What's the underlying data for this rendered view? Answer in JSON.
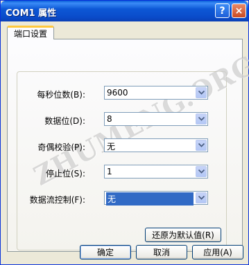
{
  "window": {
    "title": "COM1 属性",
    "help_symbol": "?",
    "close_symbol": "×"
  },
  "tabs": [
    {
      "label": "端口设置"
    }
  ],
  "watermark": "ZHUMENG.ORG",
  "fields": [
    {
      "label": "每秒位数(B):",
      "value": "9600"
    },
    {
      "label": "数据位(D):",
      "value": "8"
    },
    {
      "label": "奇偶校验(P):",
      "value": "无"
    },
    {
      "label": "停止位(S):",
      "value": "1"
    },
    {
      "label": "数据流控制(F):",
      "value": "无"
    }
  ],
  "restore_button": "还原为默认值(R)",
  "buttons": {
    "ok": "确定",
    "cancel": "取消",
    "apply": "应用(A)"
  },
  "icons": {
    "dropdown": "chevron-down-icon"
  },
  "colors": {
    "titlebar": "#0a4bc9",
    "selection": "#316ac5",
    "tab_highlight": "#ffc83c"
  }
}
